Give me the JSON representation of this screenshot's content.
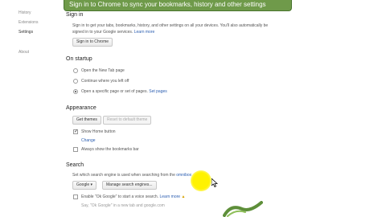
{
  "banner": {
    "text": "Sign in to Chrome to sync your bookmarks, history and other settings"
  },
  "sidebar": {
    "items": [
      {
        "label": "History"
      },
      {
        "label": "Extensions"
      },
      {
        "label": "Settings"
      },
      {
        "label": "About"
      }
    ],
    "selected": "Settings"
  },
  "sign_in": {
    "title": "Sign in",
    "desc_line1": "Sign in to get your tabs, bookmarks, history, and other settings on all your devices. You'll also automatically be",
    "desc_line2": "signed in to your Google services.",
    "learn_more": "Learn more",
    "button": "Sign in to Chrome"
  },
  "on_startup": {
    "title": "On startup",
    "options": [
      {
        "label": "Open the New Tab page",
        "checked": false
      },
      {
        "label": "Continue where you left off",
        "checked": false
      },
      {
        "label": "Open a specific page or set of pages.",
        "checked": true
      }
    ],
    "set_pages": "Set pages"
  },
  "appearance": {
    "title": "Appearance",
    "get_themes": "Get themes",
    "reset_theme": "Reset to default theme",
    "show_home": "Show Home button",
    "change": "Change",
    "show_bookmarks": "Always show the bookmarks bar"
  },
  "search": {
    "title": "Search",
    "desc": "Set which search engine is used when searching from the",
    "omnibox": "omnibox",
    "engine": "Google",
    "manage": "Manage search engines...",
    "ok_google": "Enable \"Ok Google\" to start a voice search.",
    "learn_more": "Learn more",
    "hint": "Say, \"Ok Google\" in a new tab and google.com"
  }
}
